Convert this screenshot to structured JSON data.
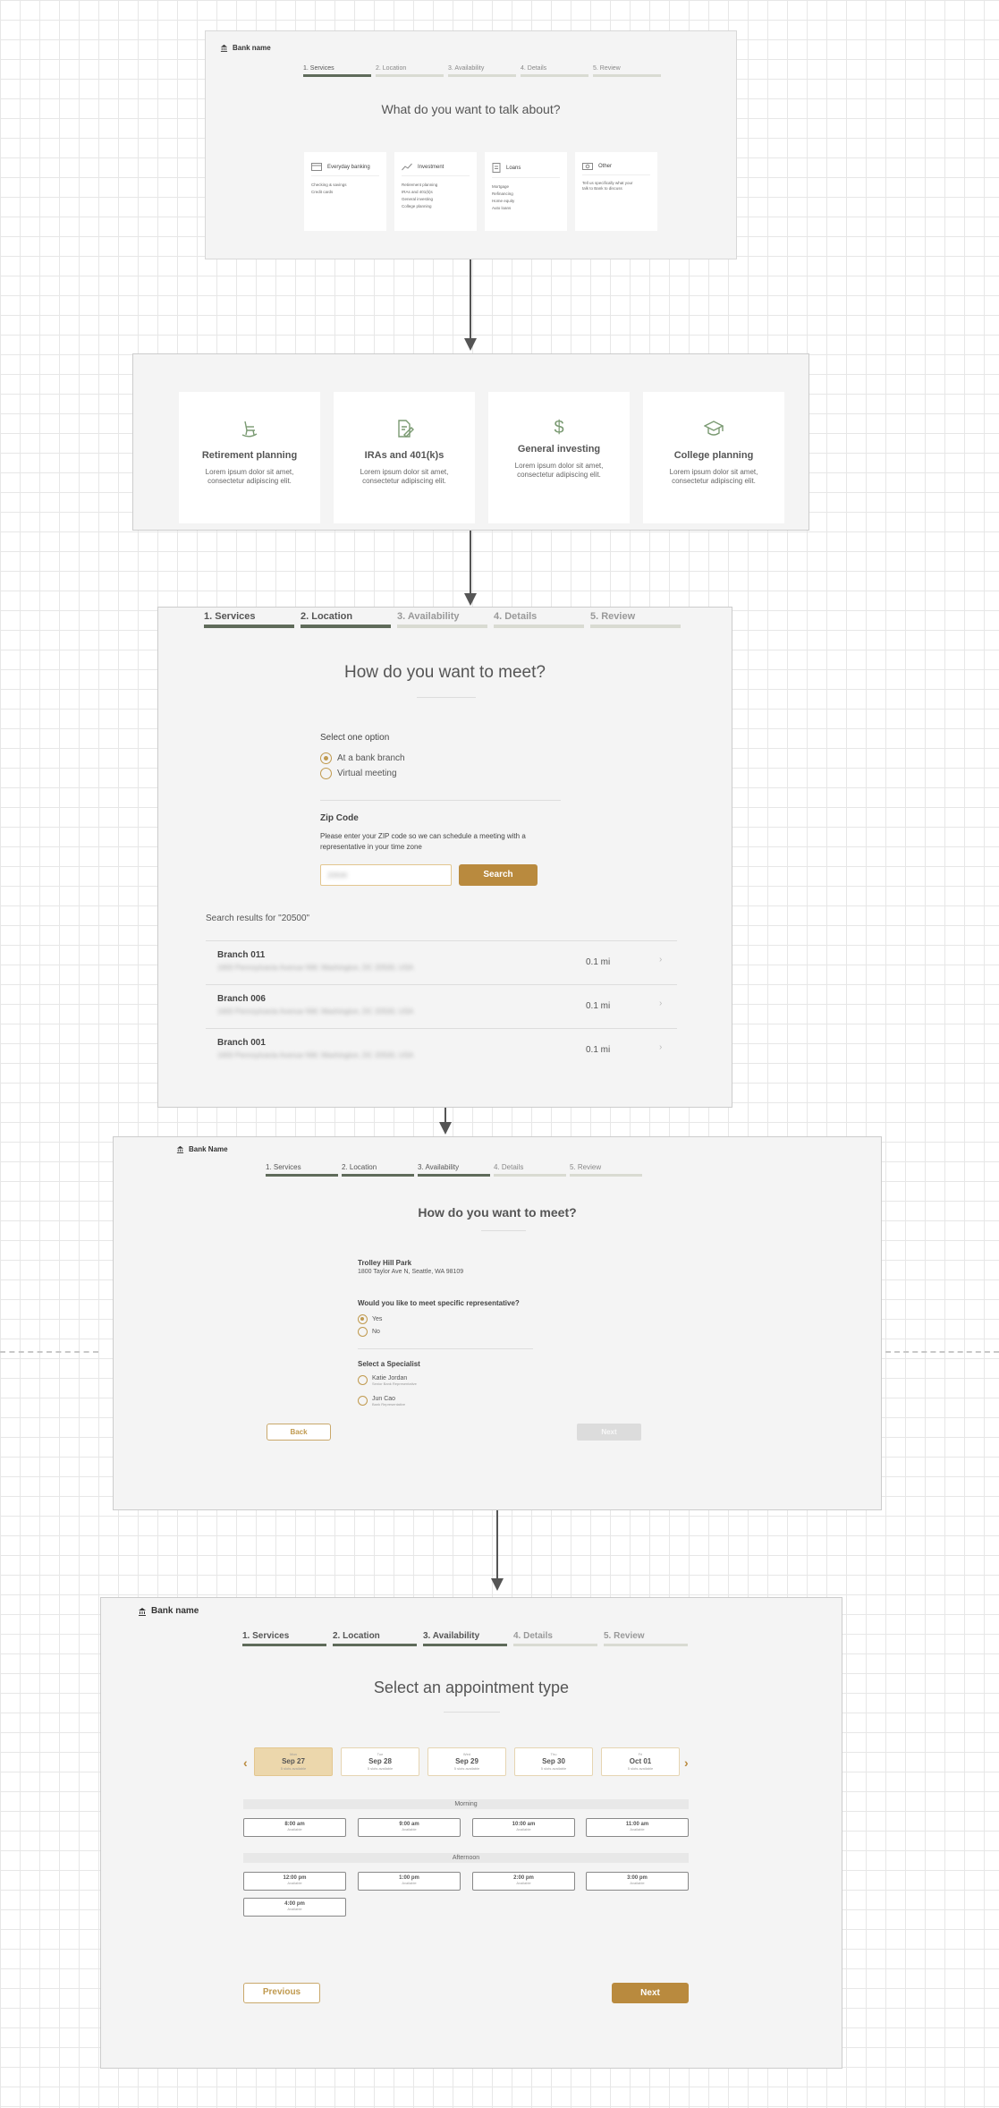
{
  "screen1": {
    "bank_name": "Bank name",
    "steps": [
      "1. Services",
      "2. Location",
      "3. Availability",
      "4. Details",
      "5. Review"
    ],
    "title": "What do you want to talk about?",
    "cards": [
      {
        "icon": "card-icon",
        "title": "Everyday banking",
        "items": [
          "Checking & savings",
          "Credit cards"
        ]
      },
      {
        "icon": "chart-trend-icon",
        "title": "Investment",
        "items": [
          "Retirement planning",
          "IRAs and 401(k)s",
          "General investing",
          "College planning"
        ]
      },
      {
        "icon": "document-icon",
        "title": "Loans",
        "items": [
          "Mortgage",
          "Refinancing",
          "Home equity",
          "Auto loans"
        ]
      },
      {
        "icon": "cash-icon",
        "title": "Other",
        "items": [
          "Tell us specifically what your",
          "talk to Bank to discuss"
        ]
      }
    ]
  },
  "screen2": {
    "cards": [
      {
        "icon": "rocking-chair-icon",
        "title": "Retirement planning",
        "desc": "Lorem ipsum dolor sit amet, consectetur adipiscing elit."
      },
      {
        "icon": "document-edit-icon",
        "title": "IRAs and 401(k)s",
        "desc": "Lorem ipsum dolor sit amet, consectetur adipiscing elit."
      },
      {
        "icon": "dollar-icon",
        "title": "General investing",
        "desc": "Lorem ipsum dolor sit amet, consectetur adipiscing elit."
      },
      {
        "icon": "graduation-cap-icon",
        "title": "College planning",
        "desc": "Lorem ipsum dolor sit amet, consectetur adipiscing elit."
      }
    ]
  },
  "screen3": {
    "steps": [
      "1. Services",
      "2. Location",
      "3. Availability",
      "4. Details",
      "5. Review"
    ],
    "title": "How do you want to meet?",
    "select_label": "Select one option",
    "options": [
      "At a bank branch",
      "Virtual meeting"
    ],
    "zip_heading": "Zip Code",
    "zip_help": "Please enter your ZIP code so we can schedule a meeting with a representative in your time zone",
    "zip_value": "20500",
    "search_button": "Search",
    "results_label": "Search results for \"20500\"",
    "branches": [
      {
        "name": "Branch 011",
        "address": "1600 Pennsylvania Avenue NW, Washington, DC 20500, USA",
        "distance": "0.1 mi"
      },
      {
        "name": "Branch 006",
        "address": "1600 Pennsylvania Avenue NW, Washington, DC 20500, USA",
        "distance": "0.1 mi"
      },
      {
        "name": "Branch 001",
        "address": "1600 Pennsylvania Avenue NW, Washington, DC 20500, USA",
        "distance": "0.1 mi"
      }
    ]
  },
  "screen4": {
    "bank_name": "Bank Name",
    "steps": [
      "1. Services",
      "2. Location",
      "3. Availability",
      "4. Details",
      "5. Review"
    ],
    "title": "How do you want to meet?",
    "branch_name": "Trolley Hill Park",
    "branch_address": "1800 Taylor Ave N, Seattle, WA 98109",
    "question": "Would you like to meet specific representative?",
    "answers": [
      "Yes",
      "No"
    ],
    "specialist_label": "Select a Specialist",
    "specialists": [
      {
        "name": "Katie Jordan",
        "role": "Senior Bank Representative"
      },
      {
        "name": "Jun Cao",
        "role": "Bank Representative"
      }
    ],
    "back_button": "Back",
    "next_button": "Next"
  },
  "screen5": {
    "bank_name": "Bank name",
    "steps": [
      "1. Services",
      "2. Location",
      "3. Availability",
      "4. Details",
      "5. Review"
    ],
    "title": "Select an appointment type",
    "dates": [
      {
        "dow": "Mon",
        "date": "Sep 27",
        "slots": "5 slots available"
      },
      {
        "dow": "Tue",
        "date": "Sep 28",
        "slots": "5 slots available"
      },
      {
        "dow": "Wed",
        "date": "Sep 29",
        "slots": "5 slots available"
      },
      {
        "dow": "Thu",
        "date": "Sep 30",
        "slots": "5 slots available"
      },
      {
        "dow": "Fri",
        "date": "Oct 01",
        "slots": "5 slots available"
      }
    ],
    "morning_label": "Morning",
    "morning_slots": [
      {
        "time": "8:00 am",
        "status": "Available"
      },
      {
        "time": "9:00 am",
        "status": "Available"
      },
      {
        "time": "10:00 am",
        "status": "Available"
      },
      {
        "time": "11:00 am",
        "status": "Available"
      }
    ],
    "afternoon_label": "Afternoon",
    "afternoon_slots": [
      {
        "time": "12:00 pm",
        "status": "Available"
      },
      {
        "time": "1:00 pm",
        "status": "Available"
      },
      {
        "time": "2:00 pm",
        "status": "Available"
      },
      {
        "time": "3:00 pm",
        "status": "Available"
      },
      {
        "time": "4:00 pm",
        "status": "Available"
      }
    ],
    "previous_button": "Previous",
    "next_button": "Next"
  },
  "colors": {
    "accent": "#b98a3e",
    "accent_light": "#ecd7ac",
    "step_active": "#5f6b5a",
    "step_inactive": "#d9dbd2",
    "icon_green": "#7a9a72"
  }
}
